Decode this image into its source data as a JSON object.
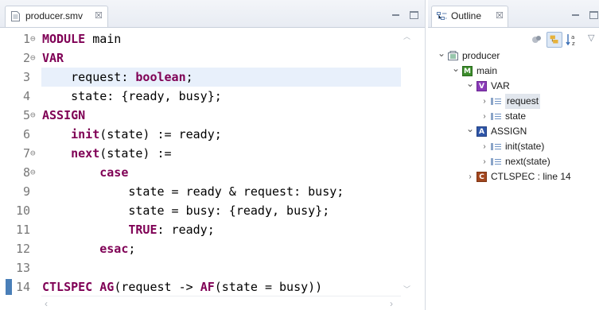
{
  "editor": {
    "tab_label": "producer.smv",
    "tab_close": "☒",
    "lines": [
      {
        "num": "1",
        "fold": "⊖",
        "parts": [
          {
            "t": "MODULE",
            "kw": true
          },
          {
            "t": " main",
            "kw": false
          }
        ]
      },
      {
        "num": "2",
        "fold": "⊖",
        "parts": [
          {
            "t": "VAR",
            "kw": true
          }
        ]
      },
      {
        "num": "3",
        "fold": "",
        "parts": [
          {
            "t": "    request: ",
            "kw": false
          },
          {
            "t": "boolean",
            "kw": true
          },
          {
            "t": ";",
            "kw": false
          }
        ]
      },
      {
        "num": "4",
        "fold": "",
        "parts": [
          {
            "t": "    state: {ready, busy};",
            "kw": false
          }
        ]
      },
      {
        "num": "5",
        "fold": "⊖",
        "parts": [
          {
            "t": "ASSIGN",
            "kw": true
          }
        ]
      },
      {
        "num": "6",
        "fold": "",
        "parts": [
          {
            "t": "    ",
            "kw": false
          },
          {
            "t": "init",
            "kw": true
          },
          {
            "t": "(state) := ready;",
            "kw": false
          }
        ]
      },
      {
        "num": "7",
        "fold": "⊖",
        "parts": [
          {
            "t": "    ",
            "kw": false
          },
          {
            "t": "next",
            "kw": true
          },
          {
            "t": "(state) :=",
            "kw": false
          }
        ]
      },
      {
        "num": "8",
        "fold": "⊖",
        "parts": [
          {
            "t": "        ",
            "kw": false
          },
          {
            "t": "case",
            "kw": true
          }
        ]
      },
      {
        "num": "9",
        "fold": "",
        "parts": [
          {
            "t": "            state = ready & request: busy;",
            "kw": false
          }
        ]
      },
      {
        "num": "10",
        "fold": "",
        "parts": [
          {
            "t": "            state = busy: {ready, busy};",
            "kw": false
          }
        ]
      },
      {
        "num": "11",
        "fold": "",
        "parts": [
          {
            "t": "            ",
            "kw": false
          },
          {
            "t": "TRUE",
            "kw": true
          },
          {
            "t": ": ready;",
            "kw": false
          }
        ]
      },
      {
        "num": "12",
        "fold": "",
        "parts": [
          {
            "t": "        ",
            "kw": false
          },
          {
            "t": "esac",
            "kw": true
          },
          {
            "t": ";",
            "kw": false
          }
        ]
      },
      {
        "num": "13",
        "fold": "",
        "parts": []
      },
      {
        "num": "14",
        "fold": "",
        "parts": [
          {
            "t": "CTLSPEC",
            "kw": true
          },
          {
            "t": " ",
            "kw": false
          },
          {
            "t": "AG",
            "kw": true
          },
          {
            "t": "(request -> ",
            "kw": false
          },
          {
            "t": "AF",
            "kw": true
          },
          {
            "t": "(state = busy))",
            "kw": false
          }
        ]
      }
    ],
    "current_line": 3,
    "marker_line": 14
  },
  "outline": {
    "tab_label": "Outline",
    "tab_close": "☒",
    "tree": [
      {
        "label": "producer",
        "icon": "smv-file-icon",
        "depth": 0,
        "twisty": "⌄",
        "kind": "file"
      },
      {
        "label": "main",
        "icon": "module-icon",
        "icon_letter": "M",
        "depth": 1,
        "twisty": "⌄",
        "kind": "module"
      },
      {
        "label": "VAR",
        "icon": "var-section-icon",
        "icon_letter": "V",
        "depth": 2,
        "twisty": "⌄",
        "kind": "var"
      },
      {
        "label": "request",
        "icon": "variable-icon",
        "depth": 3,
        "twisty": "›",
        "kind": "field",
        "selected": true
      },
      {
        "label": "state",
        "icon": "variable-icon",
        "depth": 3,
        "twisty": "›",
        "kind": "field"
      },
      {
        "label": "ASSIGN",
        "icon": "assign-section-icon",
        "icon_letter": "A",
        "depth": 2,
        "twisty": "⌄",
        "kind": "assign"
      },
      {
        "label": "init(state)",
        "icon": "assignment-icon",
        "depth": 3,
        "twisty": "›",
        "kind": "field"
      },
      {
        "label": "next(state)",
        "icon": "assignment-icon",
        "depth": 3,
        "twisty": "›",
        "kind": "field"
      },
      {
        "label": "CTLSPEC : line 14",
        "icon": "ctlspec-icon",
        "icon_letter": "C",
        "depth": 2,
        "twisty": "›",
        "kind": "ctl"
      }
    ]
  },
  "colors": {
    "keyword": "#7f0055",
    "current_line": "#e8f0fb",
    "selection": "#e1e6ed"
  }
}
